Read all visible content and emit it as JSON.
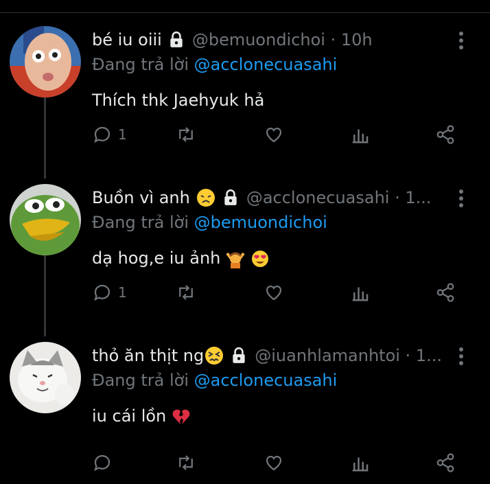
{
  "replying_prefix": "Đang trả lời",
  "tweets": [
    {
      "display_name": "bé iu oiii",
      "handle_meta": "@bemuondichoi · 10h",
      "reply_to": "@acclonecuasahi",
      "text": "Thích thk Jaehyuk hả",
      "reply_count": "1",
      "avatar": "baby-face-avatar"
    },
    {
      "display_name": "Buồn vì anh",
      "handle_meta": "@acclonecuasahi · 1...",
      "reply_to": "@bemuondichoi",
      "text": "dạ hog,e iu ảnh",
      "reply_count": "1",
      "avatar": "pepe-frog-avatar"
    },
    {
      "display_name": "thỏ ăn thịt ng",
      "handle_meta": "@iuanhlamanhtoi · 1...",
      "reply_to": "@acclonecuasahi",
      "text": "iu cái lồn",
      "reply_count": "",
      "avatar": "cat-avatar"
    }
  ],
  "colors": {
    "background": "#000000",
    "link": "#1d9bf0",
    "muted": "#71767b",
    "text": "#e7e9ea"
  }
}
